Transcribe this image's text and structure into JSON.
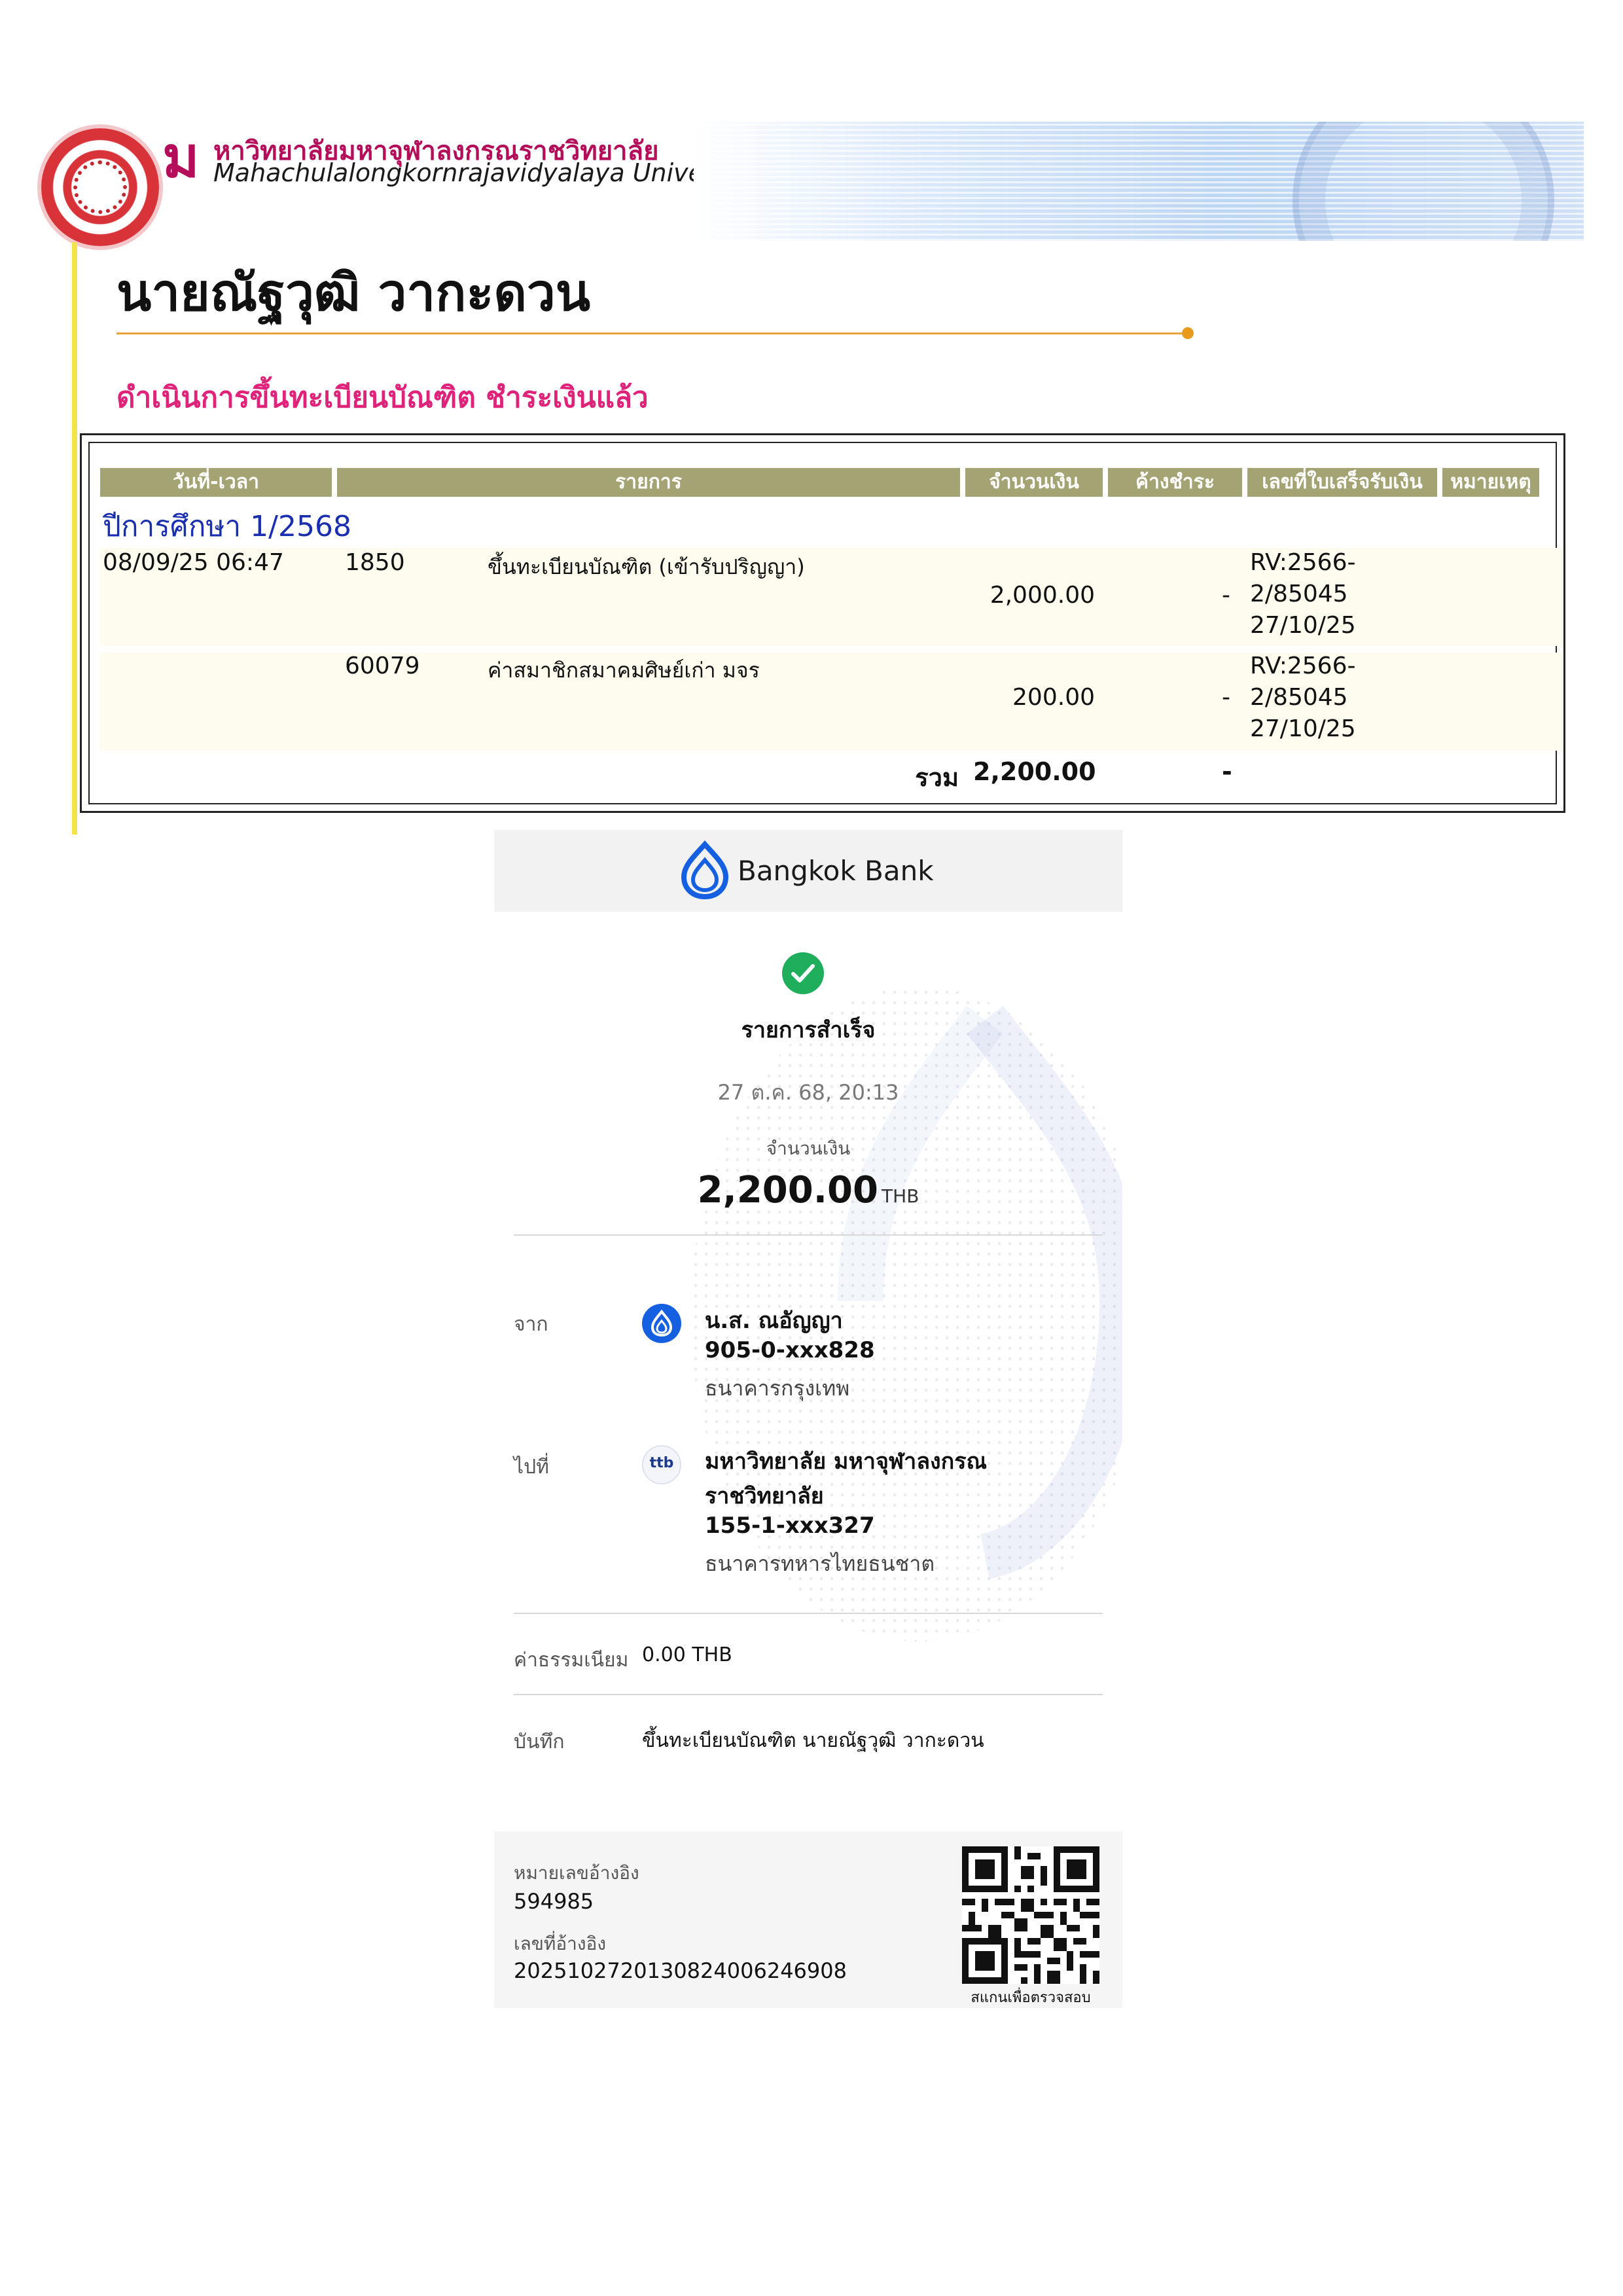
{
  "university": {
    "name_th": "หาวิทยาลัยมหาจุฬาลงกรณราชวิทยาลัย",
    "name_en": "Mahachulalongkornrajavidyalaya University",
    "monogram": "ม",
    "colors": {
      "brand_magenta": "#b40e5a",
      "status_pink": "#e0237a",
      "header_olive": "#a3a374",
      "accent_yellow": "#f5e34a",
      "term_blue": "#1a2fb0"
    }
  },
  "student": {
    "name": "นายณัฐวุฒิ วากะดวน"
  },
  "status_text": "ดำเนินการขึ้นทะเบียนบัณฑิต ชำระเงินแล้ว",
  "payment_table": {
    "headers": [
      "วันที่-เวลา",
      "รายการ",
      "จำนวนเงิน",
      "ค้างชำระ",
      "เลขที่ใบเสร็จรับเงิน",
      "หมายเหตุ"
    ],
    "term": "ปีการศึกษา 1/2568",
    "rows": [
      {
        "datetime": "08/09/25 06:47",
        "code": "1850",
        "description": "ขึ้นทะเบียนบัณฑิต (เข้ารับปริญญา)",
        "amount": "2,000.00",
        "outstanding": "-",
        "receipt_1": "RV:2566-",
        "receipt_2": "2/85045",
        "receipt_3": "27/10/25"
      },
      {
        "datetime": "",
        "code": "60079",
        "description": "ค่าสมาชิกสมาคมศิษย์เก่า มจร",
        "amount": "200.00",
        "outstanding": "-",
        "receipt_1": "RV:2566-",
        "receipt_2": "2/85045",
        "receipt_3": "27/10/25"
      }
    ],
    "total_label": "รวม",
    "total_amount": "2,200.00",
    "total_outstanding": "-"
  },
  "slip": {
    "bank_name": "Bangkok Bank",
    "status": "รายการสำเร็จ",
    "datetime": "27 ต.ค. 68, 20:13",
    "amount_label": "จำนวนเงิน",
    "amount": "2,200.00",
    "currency": "THB",
    "from_label": "จาก",
    "from_name": "น.ส. ณอัญญา",
    "from_account": "905-0-xxx828",
    "from_bank": "ธนาคารกรุงเทพ",
    "to_label": "ไปที่",
    "to_name_1": "มหาวิทยาลัย มหาจุฬาลงกรณ",
    "to_name_2": "ราชวิทยาลัย",
    "to_account": "155-1-xxx327",
    "to_bank": "ธนาคารทหารไทยธนชาต",
    "to_bank_logo": "ttb",
    "fee_label": "ค่าธรรมเนียม",
    "fee_value": "0.00 THB",
    "memo_label": "บันทึก",
    "memo_value": "ขึ้นทะเบียนบัณฑิต นายณัฐวุฒิ วากะดวน",
    "ref1_label": "หมายเลขอ้างอิง",
    "ref1_value": "594985",
    "ref2_label": "เลขที่อ้างอิง",
    "ref2_value": "2025102720130824006246908",
    "qr_caption": "สแกนเพื่อตรวจสอบ",
    "colors": {
      "success_green": "#1fae5b",
      "bbl_blue": "#1560e0",
      "header_gray": "#f2f2f2"
    }
  }
}
